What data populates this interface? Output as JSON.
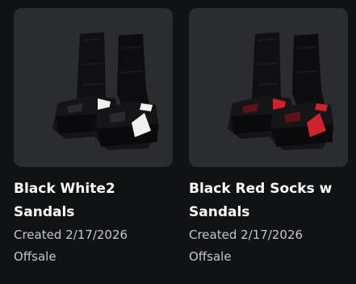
{
  "items": [
    {
      "name_line1": "Black White2",
      "name_line2": "Sandals",
      "created": "Created 2/17/2026",
      "status": "Offsale",
      "accent_color": "#f0f0f0"
    },
    {
      "name_line1": "Black Red Socks w",
      "name_line2": "Sandals",
      "created": "Created 2/17/2026",
      "status": "Offsale",
      "accent_color": "#d0222a"
    }
  ]
}
